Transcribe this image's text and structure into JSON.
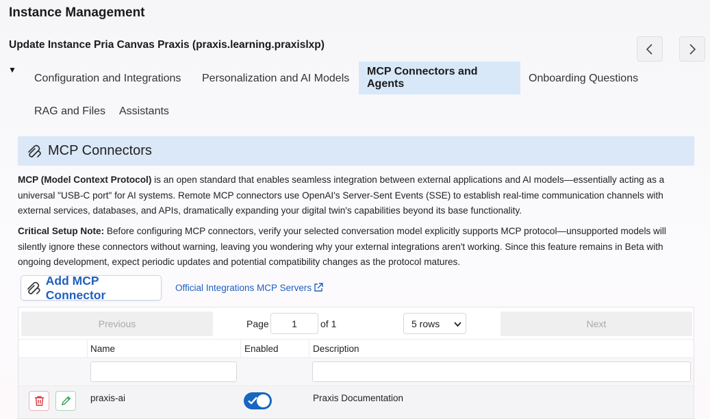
{
  "header": {
    "title": "Instance Management",
    "subtitle": "Update Instance Pria Canvas Praxis (praxis.learning.praxislxp)"
  },
  "nav": {
    "prev_icon": "chevron-left-icon",
    "next_icon": "chevron-right-icon"
  },
  "collapse_glyph": "▼",
  "tabs": [
    {
      "label": "Configuration and Integrations",
      "active": false
    },
    {
      "label": "Personalization and AI Models",
      "active": false
    },
    {
      "label": "MCP Connectors and Agents",
      "active": true
    },
    {
      "label": "Onboarding Questions",
      "active": false
    },
    {
      "label": "RAG and Files",
      "active": false
    },
    {
      "label": "Assistants",
      "active": false
    }
  ],
  "section": {
    "title": "MCP Connectors",
    "icon": "paperclip-connector-icon"
  },
  "description": {
    "p1_bold": "MCP (Model Context Protocol)",
    "p1_text": " is an open standard that enables seamless integration between external applications and AI models—essentially acting as a universal \"USB-C port\" for AI systems. Remote MCP connectors use OpenAI's Server-Sent Events (SSE) to establish real-time communication channels with external services, databases, and APIs, dramatically expanding your digital twin's capabilities beyond its base functionality.",
    "p2_bold": "Critical Setup Note:",
    "p2_text": " Before configuring MCP connectors, verify your selected conversation model explicitly supports MCP protocol—unsupported models will silently ignore these connectors without warning, leaving you wondering why your external integrations aren't working. Since this feature remains in Beta with ongoing development, expect periodic updates and potential compatibility changes as the protocol matures."
  },
  "actions": {
    "add_label": "Add MCP Connector",
    "link_label": "Official Integrations MCP Servers",
    "link_icon": "external-link-icon"
  },
  "pagination": {
    "prev_label": "Previous",
    "next_label": "Next",
    "page_label": "Page",
    "page_value": "1",
    "of_label": "of 1",
    "rows_selected": "5 rows"
  },
  "table": {
    "columns": [
      "Name",
      "Enabled",
      "Description"
    ],
    "rows": [
      {
        "name": "praxis-ai",
        "enabled": true,
        "description": "Praxis Documentation"
      }
    ]
  },
  "colors": {
    "accent": "#1f5fbf",
    "active_tab_bg": "#d8e8f8",
    "section_bg": "#dbe8f8",
    "toggle_on": "#1766c2",
    "delete": "#d9363e",
    "edit": "#2e9e4f"
  }
}
